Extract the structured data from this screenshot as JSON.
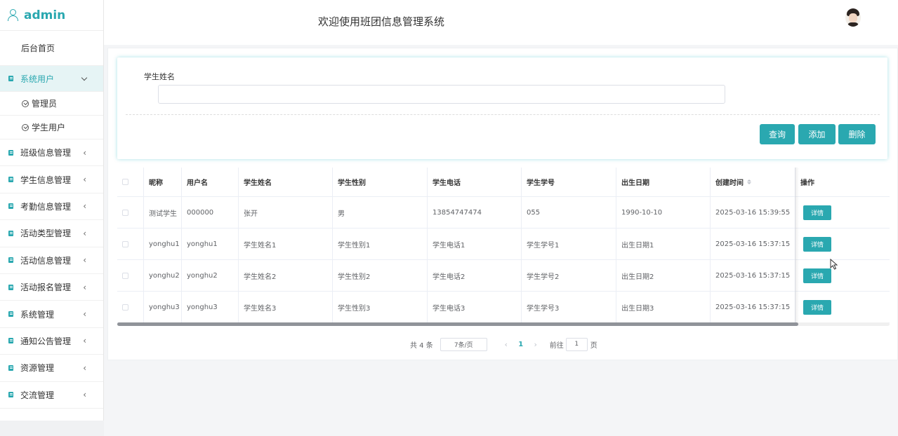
{
  "sidebar": {
    "brand": "admin",
    "home": "后台首页",
    "active_group": {
      "label": "系统用户",
      "children": [
        "管理员",
        "学生用户"
      ]
    },
    "groups": [
      "班级信息管理",
      "学生信息管理",
      "考勤信息管理",
      "活动类型管理",
      "活动信息管理",
      "活动报名管理",
      "系统管理",
      "通知公告管理",
      "资源管理",
      "交流管理"
    ]
  },
  "header": {
    "title": "欢迎使用班团信息管理系统"
  },
  "search": {
    "label": "学生姓名",
    "value": "",
    "buttons": {
      "query": "查询",
      "add": "添加",
      "delete": "删除"
    }
  },
  "table": {
    "columns": [
      "昵称",
      "用户名",
      "学生姓名",
      "学生性别",
      "学生电话",
      "学生学号",
      "出生日期",
      "创建时间",
      "操作"
    ],
    "rows": [
      [
        "测试学生",
        "000000",
        "张开",
        "男",
        "13854747474",
        "055",
        "1990-10-10",
        "2025-03-16 15:39:55"
      ],
      [
        "yonghu1",
        "yonghu1",
        "学生姓名1",
        "学生性别1",
        "学生电话1",
        "学生学号1",
        "出生日期1",
        "2025-03-16 15:37:15"
      ],
      [
        "yonghu2",
        "yonghu2",
        "学生姓名2",
        "学生性别2",
        "学生电话2",
        "学生学号2",
        "出生日期2",
        "2025-03-16 15:37:15"
      ],
      [
        "yonghu3",
        "yonghu3",
        "学生姓名3",
        "学生性别3",
        "学生电话3",
        "学生学号3",
        "出生日期3",
        "2025-03-16 15:37:15"
      ]
    ],
    "detail_label": "详情"
  },
  "pagination": {
    "total": "共 4 条",
    "page_size": "7条/页",
    "current_page": "1",
    "goto_label": "前往",
    "goto_value": "1",
    "page_suffix": "页"
  },
  "colors": {
    "accent": "#2aa8b0"
  }
}
